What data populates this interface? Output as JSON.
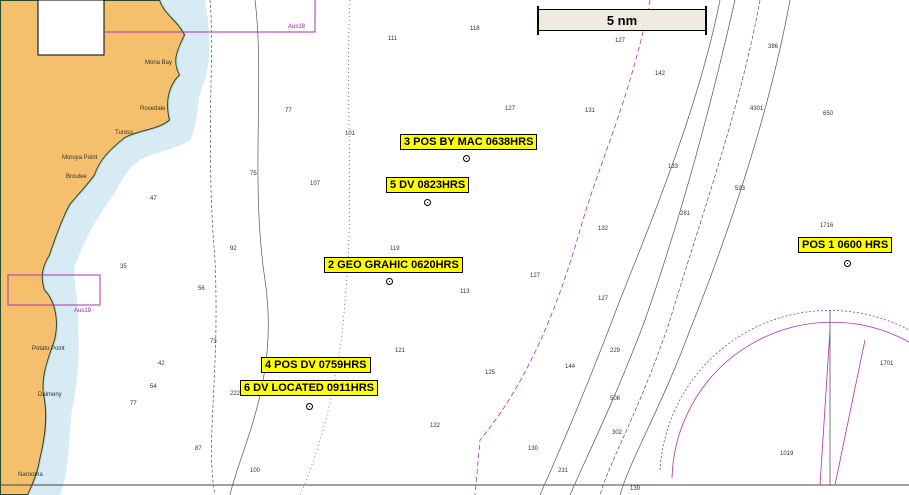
{
  "scale_bar": {
    "label": "5 nm"
  },
  "positions": [
    {
      "id": "pos1",
      "label": "POS 1 0600 HRS"
    },
    {
      "id": "pos2",
      "label": "2 GEO GRAHIC 0620HRS"
    },
    {
      "id": "pos3",
      "label": "3 POS BY MAC 0638HRS"
    },
    {
      "id": "pos4",
      "label": "4 POS DV 0759HRS"
    },
    {
      "id": "pos5",
      "label": "5 DV 0823HRS"
    },
    {
      "id": "pos6",
      "label": "6 DV LOCATED  0911HRS"
    }
  ],
  "place_names": [
    "Mona Bay",
    "Rosedale",
    "Tuross",
    "Moruya Point",
    "Broulee",
    "Potato Point",
    "Dalmeny",
    "Narooma"
  ],
  "magenta_labels": [
    "Aus18",
    "Aus19"
  ],
  "colors": {
    "land": "#f5c06e",
    "shallow": "#cfe8f2",
    "highlight": "#ffff00",
    "magenta": "#b030b0"
  }
}
